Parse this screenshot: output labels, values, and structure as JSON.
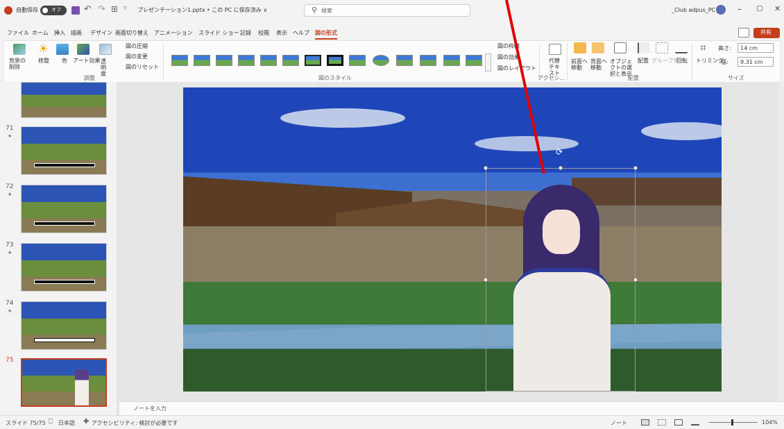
{
  "titlebar": {
    "autosave_label": "自動保存",
    "autosave_state": "オフ",
    "file_title": "プレゼンテーション1.pptx • この PC に保存済み ∨",
    "search_placeholder": "検索",
    "user_name": "_Club adpus_PC"
  },
  "menu": {
    "tabs": [
      "ファイル",
      "ホーム",
      "挿入",
      "描画",
      "デザイン",
      "画面切り替え",
      "アニメーション",
      "スライド ショー",
      "記録",
      "校閲",
      "表示",
      "ヘルプ",
      "図の形式"
    ],
    "active_tab": "図の形式",
    "share_label": "共有"
  },
  "ribbon": {
    "adjust": {
      "remove_bg": "背景の削除",
      "corrections": "修整",
      "color": "色",
      "artistic": "アート効果",
      "transparency": "透明度",
      "compress": "図の圧縮",
      "change": "図の変更",
      "reset": "図のリセット",
      "group_label": "調整"
    },
    "styles_group_label": "図のスタイル",
    "picture_border": "図の枠線",
    "picture_effects": "図の効果",
    "picture_layout": "図のレイアウト",
    "accessibility": {
      "alt_text": "代替テキスト",
      "group_label": "アクセシ..."
    },
    "arrange": {
      "bring_forward": "前面へ移動",
      "send_backward": "背面へ移動",
      "selection_pane": "オブジェクトの選択と表示",
      "align": "配置",
      "group": "グループ化",
      "rotate": "回転",
      "group_label": "配置"
    },
    "size": {
      "crop": "トリミング",
      "height_label": "高さ:",
      "height_value": "14 cm",
      "width_label": "幅:",
      "width_value": "9.31 cm",
      "group_label": "サイズ"
    }
  },
  "thumbnails": [
    {
      "number": "71",
      "caption": "これは少し話をして、そして見回した"
    },
    {
      "number": "72",
      "caption": "彼らは話し合い、少し歩いた"
    },
    {
      "number": "73",
      "caption": "彼は道の途中で立ち止まった。彼女はいろいろ話した"
    },
    {
      "number": "74",
      "caption": "二人は村の入口で話しながら、手を振って別れた"
    },
    {
      "number": "75",
      "caption": ""
    }
  ],
  "notes_placeholder": "ノートを入力",
  "status": {
    "slide_info": "スライド 75/75",
    "language": "日本語",
    "accessibility": "アクセシビリティ: 検討が必要です",
    "notes_button": "ノート",
    "zoom": "104%"
  },
  "colors": {
    "accent": "#c43e1c",
    "sky": "#2a56c6",
    "arrow": "#e00000"
  },
  "icons": [
    "autosave-toggle-icon",
    "save-icon",
    "undo-icon",
    "redo-icon",
    "search-icon",
    "minimize-icon",
    "maximize-icon",
    "close-icon",
    "comment-icon",
    "rotate-handle-icon"
  ]
}
